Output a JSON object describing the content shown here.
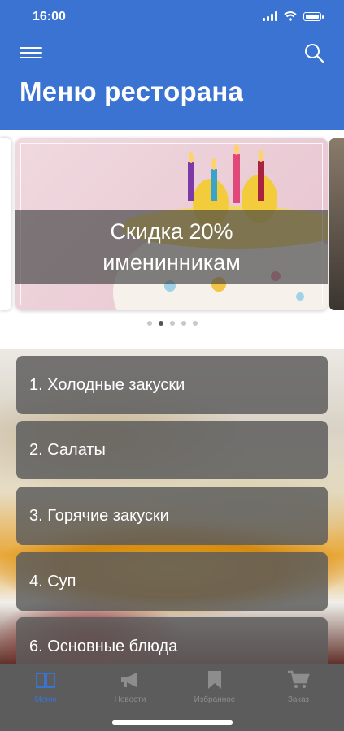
{
  "status_bar": {
    "time": "16:00"
  },
  "header": {
    "title": "Меню ресторана",
    "color": "#3a73d2"
  },
  "promo": {
    "banner_text_line1": "Скидка 20%",
    "banner_text_line2": "именинникам",
    "active_slide": 2,
    "slide_count": 5
  },
  "categories": [
    {
      "label": "1. Холодные закуски"
    },
    {
      "label": "2. Салаты"
    },
    {
      "label": "3. Горячие закуски"
    },
    {
      "label": "4. Суп"
    },
    {
      "label": "6. Основные блюда"
    }
  ],
  "tabbar": {
    "tabs": [
      {
        "label": "Меню",
        "icon": "book-icon",
        "active": true
      },
      {
        "label": "Новости",
        "icon": "megaphone-icon"
      },
      {
        "label": "Избранное",
        "icon": "bookmark-icon"
      },
      {
        "label": "Заказ",
        "icon": "cart-icon"
      }
    ],
    "active_color": "#3a73d2"
  }
}
